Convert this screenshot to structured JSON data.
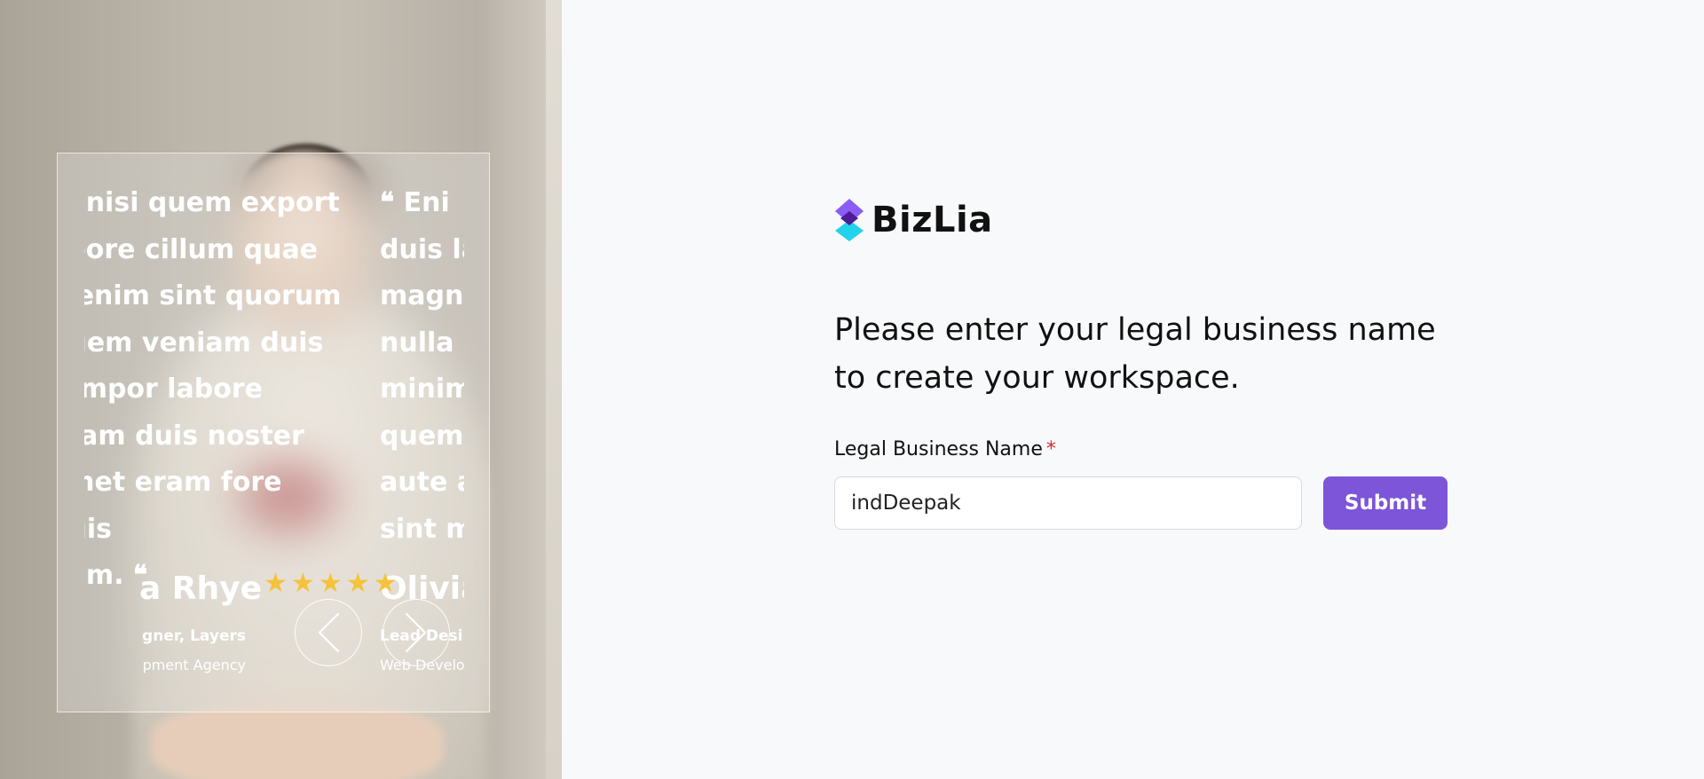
{
  "testimonials": [
    {
      "quote": "m nisi quem export\nabore cillum quae\na enim sint quorum\nquem veniam duis\n tempor labore\n eram duis noster\namet eram fore quis\ninim. ",
      "close_mark": "❝",
      "author": "a Rhye",
      "role": "gner, Layers",
      "org": "pment Agency"
    },
    {
      "open_mark": "❝",
      "quote": " Eni\nduis la\nmagn\nnulla c\nminim\nquem\naute a\nsint m",
      "author": "Olivia",
      "role": "Lead Desi",
      "org": "Web Develo"
    }
  ],
  "rating": {
    "stars": 5,
    "icon": "star-icon",
    "color": "#f5c33b"
  },
  "nav": {
    "prev_icon": "chevron-left-icon",
    "next_icon": "chevron-right-icon"
  },
  "brand": {
    "name": "BizLia",
    "logo_icon": "diamond-stack-icon",
    "colors": {
      "top": "#8b5cf6",
      "middle": "#4c1d95",
      "bottom": "#22d3ee"
    }
  },
  "form": {
    "prompt": "Please enter your legal business name to create your workspace.",
    "label": "Legal Business Name",
    "required_marker": "*",
    "value": "indDeepak",
    "submit_label": "Submit"
  },
  "colors": {
    "accent": "#7c55d8",
    "required": "#d22a2a",
    "background": "#f8f9fb"
  }
}
